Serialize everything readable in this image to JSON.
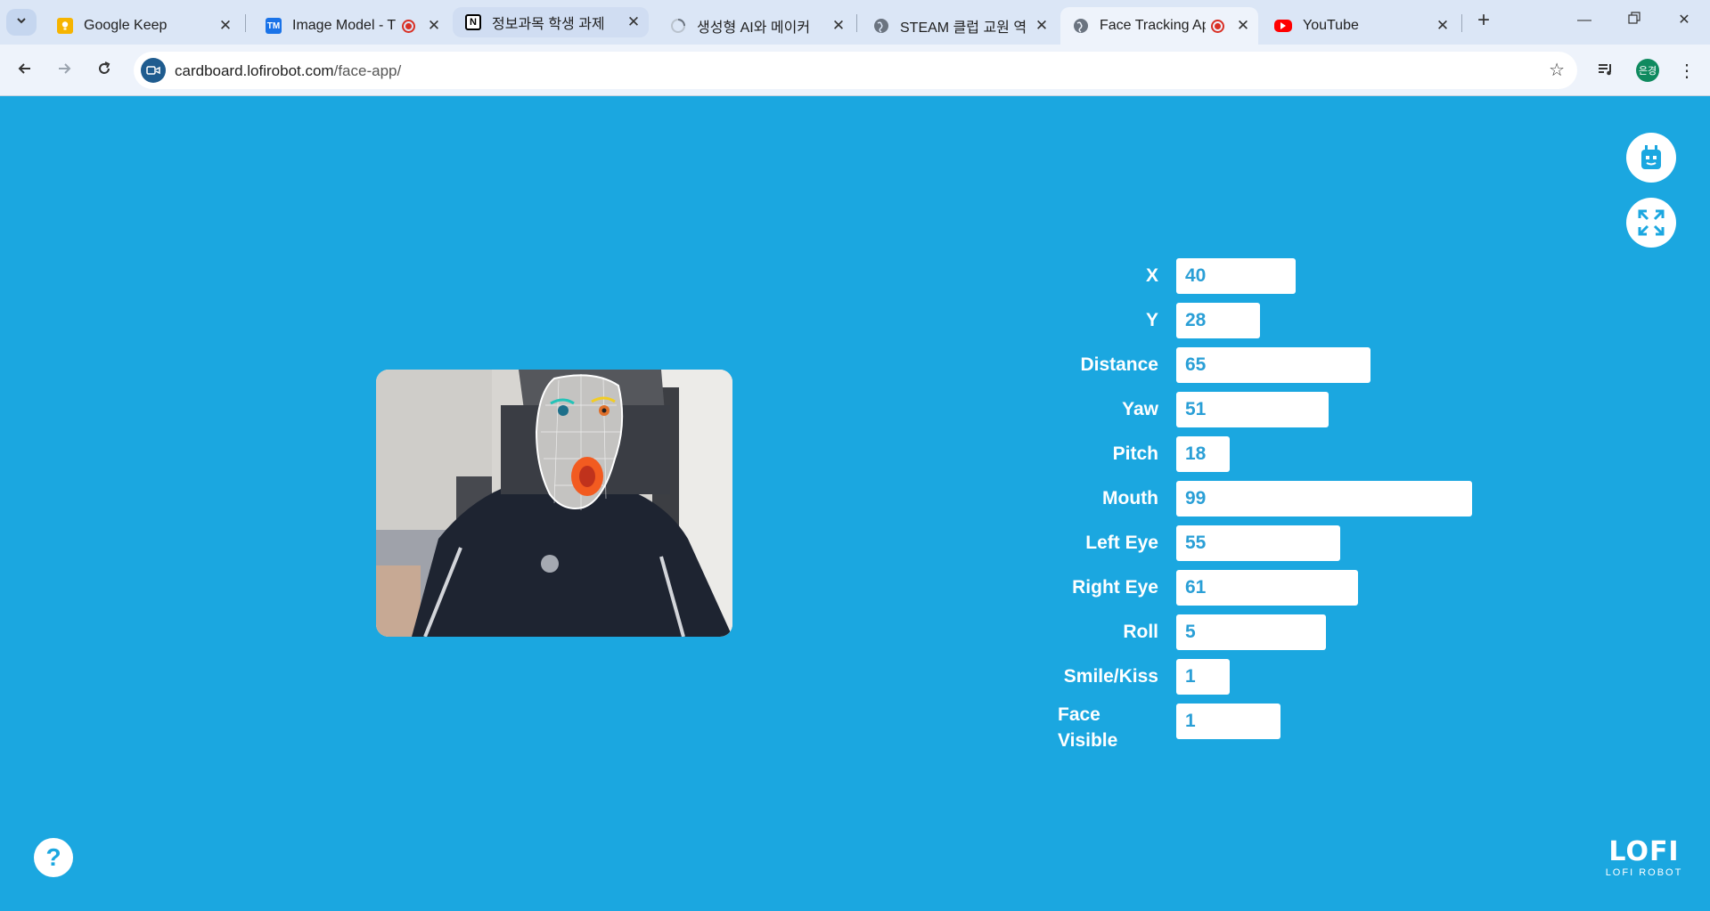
{
  "browser": {
    "tabs": [
      {
        "title": "Google Keep",
        "favicon": "google-keep-icon",
        "color": "#f6b400"
      },
      {
        "title": "Image Model - T",
        "favicon": "teachable-machine-icon",
        "color": "#1a73e8"
      },
      {
        "title": "정보과목 학생 과제",
        "favicon": "notion-icon",
        "color": "#000000"
      },
      {
        "title": "생성형 AI와 메이커",
        "favicon": "loading-icon",
        "color": "#9aa3ae"
      },
      {
        "title": "STEAM 클럽 교원 역",
        "favicon": "globe-icon",
        "color": "#5f6368"
      },
      {
        "title": "Face Tracking Ap",
        "favicon": "globe-icon",
        "color": "#5f6368"
      },
      {
        "title": "YouTube",
        "favicon": "youtube-icon",
        "color": "#ff0000"
      }
    ],
    "address": {
      "domain": "cardboard.lofirobot.com",
      "path": "/face-app/"
    },
    "profile_initials": "은경"
  },
  "stats": [
    {
      "label": "X",
      "value": "40",
      "fraction": 0.4
    },
    {
      "label": "Y",
      "value": "28",
      "fraction": 0.28
    },
    {
      "label": "Distance",
      "value": "65",
      "fraction": 0.65
    },
    {
      "label": "Yaw",
      "value": "51",
      "fraction": 0.51
    },
    {
      "label": "Pitch",
      "value": "18",
      "fraction": 0.18
    },
    {
      "label": "Mouth",
      "value": "99",
      "fraction": 0.99
    },
    {
      "label": "Left Eye",
      "value": "55",
      "fraction": 0.55
    },
    {
      "label": "Right Eye",
      "value": "61",
      "fraction": 0.61
    },
    {
      "label": "Roll",
      "value": "5",
      "fraction": 0.5
    },
    {
      "label": "Smile/Kiss",
      "value": "1",
      "fraction": 0.1
    },
    {
      "label": "Face Visible",
      "value": "1",
      "fraction": 0.35
    }
  ],
  "help_label": "?",
  "logo": {
    "big": "LOFI",
    "small": "LOFI ROBOT"
  }
}
